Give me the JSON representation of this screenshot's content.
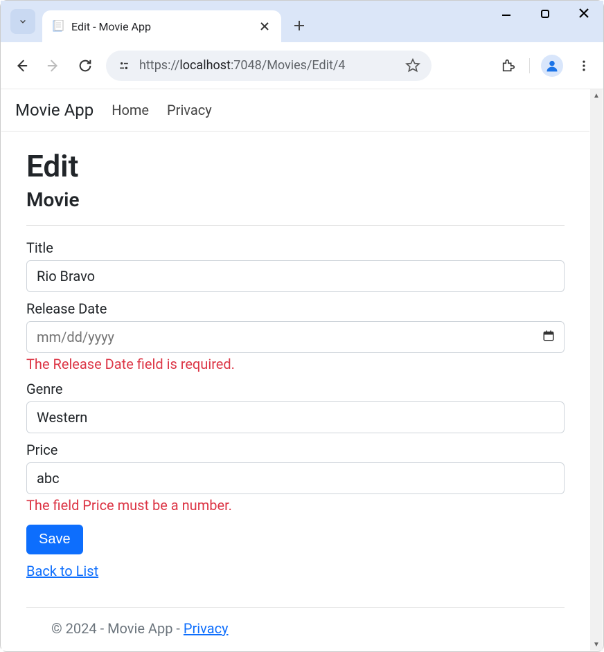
{
  "browser": {
    "tab_title": "Edit - Movie App",
    "url_display_prefix": "https://",
    "url_display_host": "localhost",
    "url_display_port_path": ":7048/Movies/Edit/4"
  },
  "nav": {
    "brand": "Movie App",
    "home": "Home",
    "privacy": "Privacy"
  },
  "page": {
    "title": "Edit",
    "subtitle": "Movie"
  },
  "form": {
    "title": {
      "label": "Title",
      "value": "Rio Bravo"
    },
    "release_date": {
      "label": "Release Date",
      "placeholder": "mm/dd/yyyy",
      "error": "The Release Date field is required."
    },
    "genre": {
      "label": "Genre",
      "value": "Western"
    },
    "price": {
      "label": "Price",
      "value": "abc",
      "error": "The field Price must be a number."
    },
    "save": "Save",
    "back": "Back to List"
  },
  "footer": {
    "text": "© 2024 - Movie App - ",
    "privacy": "Privacy"
  }
}
